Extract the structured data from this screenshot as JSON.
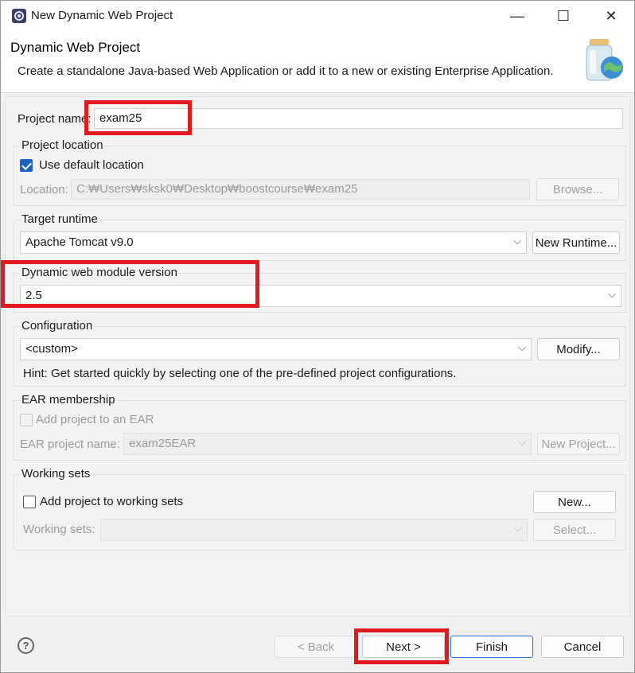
{
  "window": {
    "title": "New Dynamic Web Project",
    "minimize_glyph": "—",
    "maximize_glyph": "☐",
    "close_glyph": "✕"
  },
  "header": {
    "title": "Dynamic Web Project",
    "description": "Create a standalone Java-based Web Application or add it to a new or existing Enterprise Application."
  },
  "project_name": {
    "label": "Project name:",
    "value": "exam25"
  },
  "project_location": {
    "group_label": "Project location",
    "use_default_label": "Use default location",
    "use_default_checked": true,
    "location_label": "Location:",
    "location_value": "C:₩Users₩sksk0₩Desktop₩boostcourse₩exam25",
    "browse_label": "Browse..."
  },
  "target_runtime": {
    "group_label": "Target runtime",
    "value": "Apache Tomcat v9.0",
    "new_runtime_label": "New Runtime..."
  },
  "module_version": {
    "group_label": "Dynamic web module version",
    "value": "2.5"
  },
  "configuration": {
    "group_label": "Configuration",
    "value": "<custom>",
    "modify_label": "Modify...",
    "hint": "Hint: Get started quickly by selecting one of the pre-defined project configurations."
  },
  "ear": {
    "group_label": "EAR membership",
    "add_label": "Add project to an EAR",
    "name_label": "EAR project name:",
    "name_value": "exam25EAR",
    "new_project_label": "New Project..."
  },
  "working_sets": {
    "group_label": "Working sets",
    "add_label": "Add project to working sets",
    "new_label": "New...",
    "sets_label": "Working sets:",
    "select_label": "Select..."
  },
  "footer": {
    "help_glyph": "?",
    "back_label": "< Back",
    "next_label": "Next >",
    "finish_label": "Finish",
    "cancel_label": "Cancel"
  },
  "colors": {
    "highlight_box": "#e11b1b",
    "checkbox_accent": "#1a62c4",
    "default_button_border": "#2a72c9"
  },
  "icons": {
    "app": "eclipse-gear-icon",
    "banner": "web-project-jar-globe-icon"
  }
}
